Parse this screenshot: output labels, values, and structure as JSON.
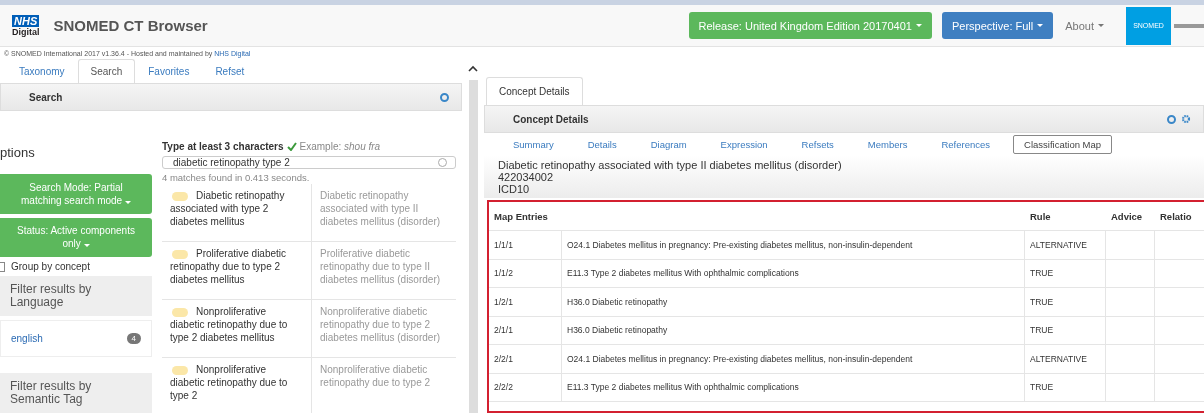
{
  "header": {
    "logo_top": "NHS",
    "logo_bottom": "Digital",
    "title": "SNOMED CT Browser",
    "release_button": "Release: United Kingdom Edition 20170401",
    "perspective_button": "Perspective: Full",
    "about_menu": "About",
    "partner_logo": "SNOMED"
  },
  "copyright": {
    "text": "© SNOMED International 2017 v1.36.4 - Hosted and maintained by ",
    "link": "NHS Digital"
  },
  "left_tabs": [
    {
      "label": "Taxonomy",
      "selected": false
    },
    {
      "label": "Search",
      "selected": true
    },
    {
      "label": "Favorites",
      "selected": false
    },
    {
      "label": "Refset",
      "selected": false
    }
  ],
  "search_panel": {
    "title": "Search",
    "options_title": "ptions",
    "search_mode": "Search Mode: Partial matching search mode",
    "status": "Status: Active components only",
    "group_by": {
      "label": "Group by concept",
      "checked": false
    },
    "filters": [
      {
        "title": "Filter results by Language",
        "items": [
          {
            "label": "english",
            "count": "4"
          }
        ]
      },
      {
        "title": "Filter results by Semantic Tag"
      }
    ],
    "hint": "Type at least 3 characters",
    "example": "Example: *shou fra*",
    "query": "diabetic retinopathy type 2",
    "summary": "4 matches found in 0.413 seconds.",
    "results": [
      {
        "term": "Diabetic retinopathy associated with type 2 diabetes mellitus",
        "fsn": "Diabetic retinopathy associated with type II diabetes mellitus (disorder)"
      },
      {
        "term": "Proliferative diabetic retinopathy due to type 2 diabetes mellitus",
        "fsn": "Proliferative diabetic retinopathy due to type II diabetes mellitus (disorder)"
      },
      {
        "term": "Nonproliferative diabetic retinopathy due to type 2 diabetes mellitus",
        "fsn": "Nonproliferative diabetic retinopathy due to type 2 diabetes mellitus (disorder)"
      },
      {
        "term": "Nonproliferative diabetic retinopathy due to type 2",
        "fsn": "Nonproliferative diabetic retinopathy due to type 2"
      }
    ]
  },
  "details_panel": {
    "tab": "Concept Details",
    "title": "Concept Details",
    "subtabs": [
      {
        "label": "Summary",
        "selected": false
      },
      {
        "label": "Details",
        "selected": false
      },
      {
        "label": "Diagram",
        "selected": false
      },
      {
        "label": "Expression",
        "selected": false
      },
      {
        "label": "Refsets",
        "selected": false
      },
      {
        "label": "Members",
        "selected": false
      },
      {
        "label": "References",
        "selected": false
      },
      {
        "label": "Classification Map",
        "selected": true
      }
    ],
    "concept_name": "Diabetic retinopathy associated with type II diabetes mellitus (disorder)",
    "concept_id": "422034002",
    "map_name": "ICD10",
    "table": {
      "columns": [
        "Map Entries",
        "",
        "Rule",
        "Advice",
        "Relatio"
      ],
      "rows": [
        [
          "1/1/1",
          "O24.1 Diabetes mellitus in pregnancy: Pre-existing diabetes mellitus, non-insulin-dependent",
          "ALTERNATIVE"
        ],
        [
          "1/1/2",
          "E11.3 Type 2 diabetes mellitus With ophthalmic complications",
          "TRUE"
        ],
        [
          "1/2/1",
          "H36.0 Diabetic retinopathy",
          "TRUE"
        ],
        [
          "2/1/1",
          "H36.0 Diabetic retinopathy",
          "TRUE"
        ],
        [
          "2/2/1",
          "O24.1 Diabetes mellitus in pregnancy: Pre-existing diabetes mellitus, non-insulin-dependent",
          "ALTERNATIVE"
        ],
        [
          "2/2/2",
          "E11.3 Type 2 diabetes mellitus With ophthalmic complications",
          "TRUE"
        ]
      ]
    }
  }
}
